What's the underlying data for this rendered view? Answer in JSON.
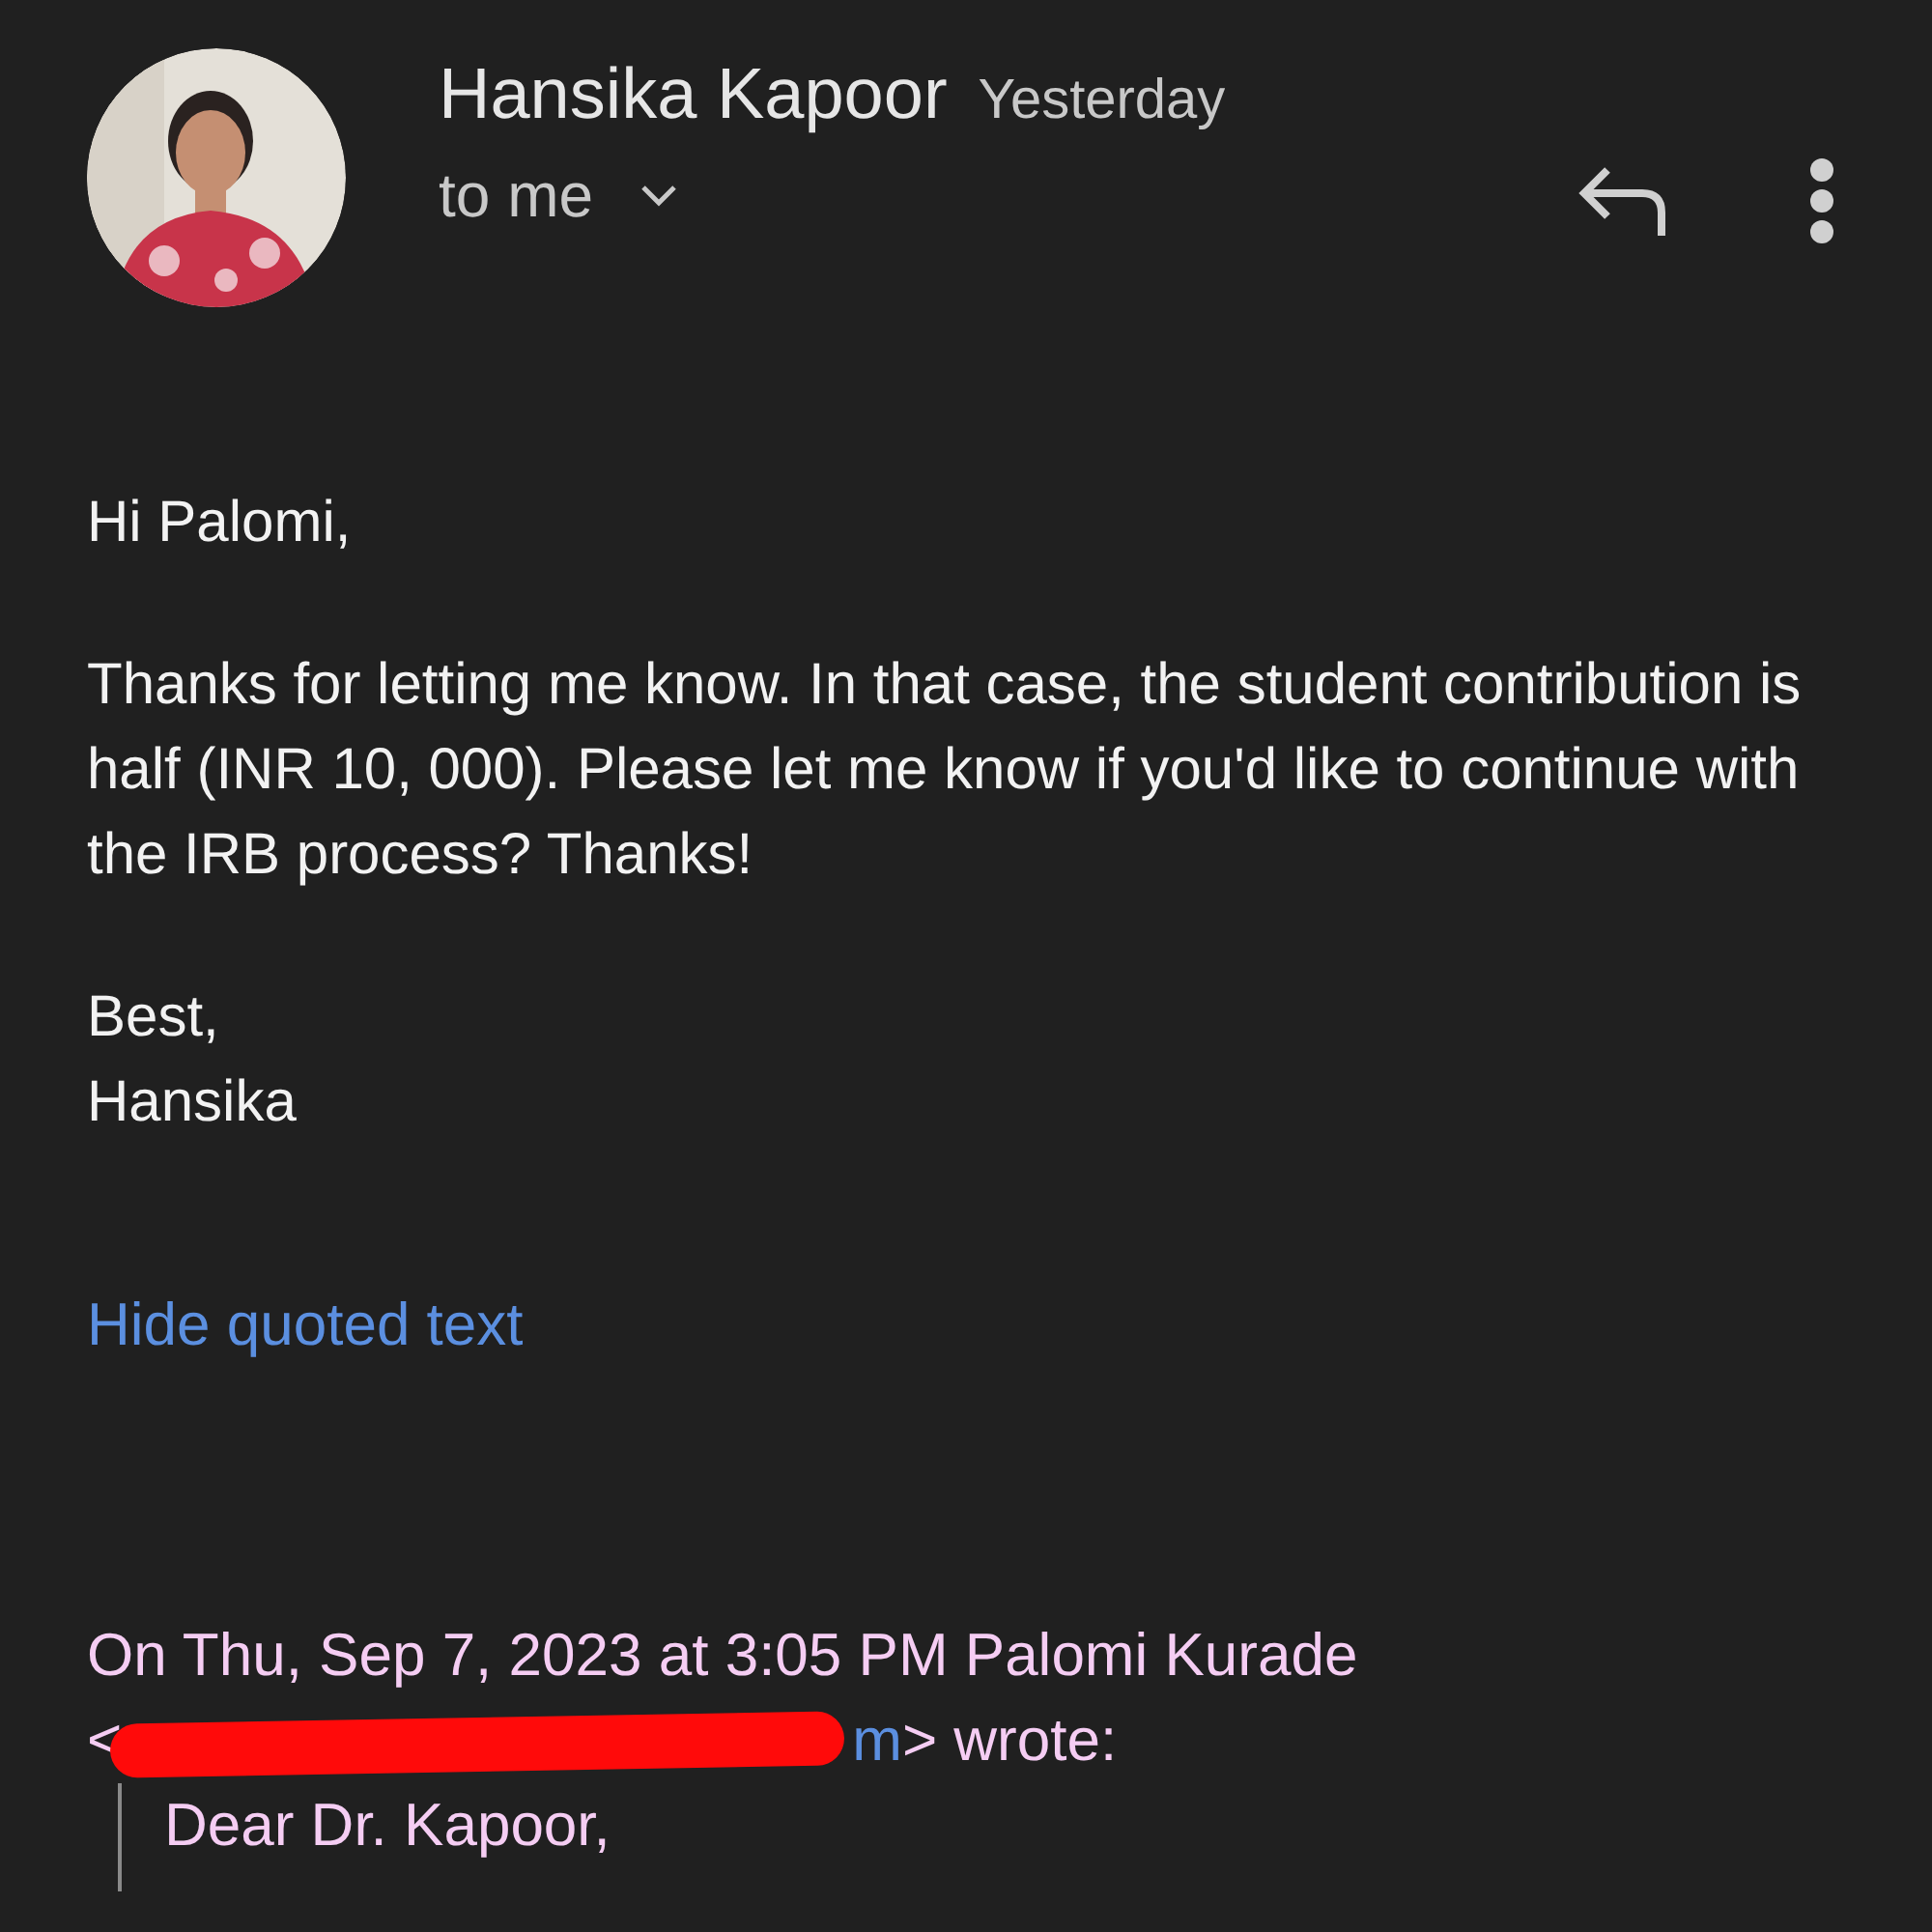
{
  "header": {
    "sender": "Hansika Kapoor",
    "time": "Yesterday",
    "recipient": "to me"
  },
  "body": [
    "Hi Palomi,",
    "Thanks for letting me know. In that case, the student contribution is half (INR 10, 000). Please let me know if you'd like to continue with the IRB process? Thanks!",
    "Best,\nHansika"
  ],
  "quoted_toggle": "Hide quoted text",
  "quote": {
    "header": "On Thu, Sep 7, 2023 at 3:05 PM Palomi Kurade",
    "email_open": "<",
    "email_visible": "m",
    "email_close": "> wrote:",
    "redacted": true,
    "lines": [
      "Dear Dr. Kapoor,"
    ]
  }
}
